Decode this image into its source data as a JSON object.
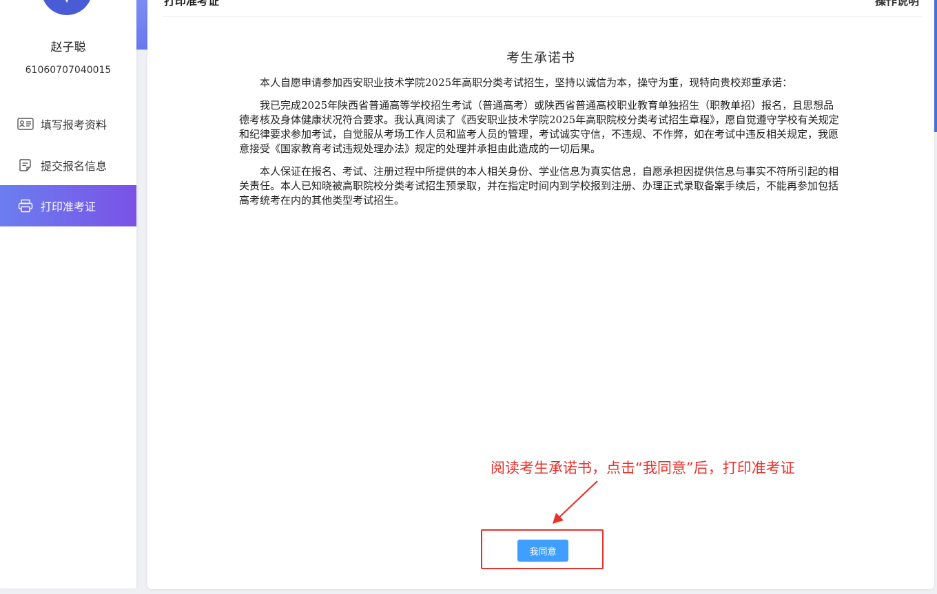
{
  "user": {
    "name": "赵子聪",
    "id": "61060707040015"
  },
  "sidebar": {
    "items": [
      {
        "label": "填写报考资料",
        "icon": "id-card-icon",
        "active": false
      },
      {
        "label": "提交报名信息",
        "icon": "document-edit-icon",
        "active": false
      },
      {
        "label": "打印准考证",
        "icon": "printer-icon",
        "active": true
      }
    ]
  },
  "header": {
    "breadcrumb": "打印准考证",
    "help": "操作说明"
  },
  "document": {
    "title": "考生承诺书",
    "paragraphs": [
      "本人自愿申请参加西安职业技术学院2025年高职分类考试招生，坚持以诚信为本，操守为重，现特向贵校郑重承诺：",
      "我已完成2025年陕西省普通高等学校招生考试（普通高考）或陕西省普通高校职业教育单独招生（职教单招）报名，且思想品德考核及身体健康状况符合要求。我认真阅读了《西安职业技术学院2025年高职院校分类考试招生章程》，愿自觉遵守学校有关规定和纪律要求参加考试，自觉服从考场工作人员和监考人员的管理，考试诚实守信，不违规、不作弊，如在考试中违反相关规定，我愿意接受《国家教育考试违规处理办法》规定的处理并承担由此造成的一切后果。",
      "本人保证在报名、考试、注册过程中所提供的本人相关身份、学业信息为真实信息，自愿承担因提供信息与事实不符所引起的相关责任。本人已知晓被高职院校分类考试招生预录取，并在指定时间内到学校报到注册、办理正式录取备案手续后，不能再参加包括高考统考在内的其他类型考试招生。"
    ]
  },
  "annotation": {
    "text": "阅读考生承诺书，点击“我同意”后，打印准考证",
    "color": "#e8312a"
  },
  "actions": {
    "agree_label": "我同意"
  },
  "colors": {
    "accent": "#409eff",
    "nav_active_start": "#6b7ef0",
    "nav_active_end": "#7a52e6"
  }
}
